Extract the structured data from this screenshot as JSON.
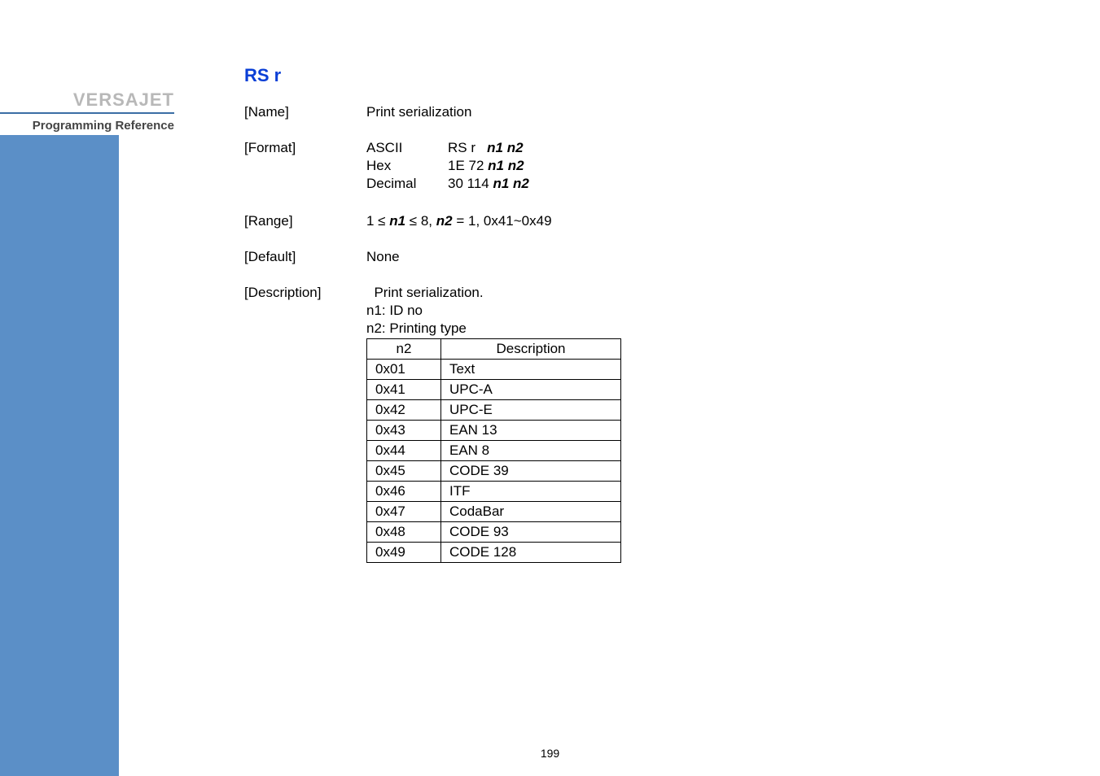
{
  "sidebar": {
    "brand": "VERSAJET",
    "reference": "Programming Reference"
  },
  "command": {
    "title": "RS r"
  },
  "name": {
    "label": "[Name]",
    "value": "Print serialization"
  },
  "format": {
    "label": "[Format]",
    "ascii_key": "ASCII",
    "ascii_prefix": "RS r   ",
    "ascii_args": "n1 n2",
    "hex_key": "Hex",
    "hex_prefix": "1E 72 ",
    "hex_args": "n1 n2",
    "dec_key": "Decimal",
    "dec_prefix": "30 114 ",
    "dec_args": "n1 n2"
  },
  "range": {
    "label": "[Range]",
    "p1": "1 ≤ ",
    "p2": "n1",
    "p3": " ≤ 8, ",
    "p4": "n2",
    "p5": " = 1, 0x41~0x49"
  },
  "default": {
    "label": "[Default]",
    "value": "None"
  },
  "description": {
    "label": "[Description]",
    "line1": "  Print serialization.",
    "line2": "n1: ID no",
    "line3": "n2: Printing type",
    "th_n2": "n2",
    "th_desc": "Description",
    "rows": [
      {
        "code": "0x01",
        "desc": "Text"
      },
      {
        "code": "0x41",
        "desc": "UPC-A"
      },
      {
        "code": "0x42",
        "desc": "UPC-E"
      },
      {
        "code": "0x43",
        "desc": "EAN 13"
      },
      {
        "code": "0x44",
        "desc": "EAN 8"
      },
      {
        "code": "0x45",
        "desc": "CODE 39"
      },
      {
        "code": "0x46",
        "desc": "ITF"
      },
      {
        "code": "0x47",
        "desc": "CodaBar"
      },
      {
        "code": "0x48",
        "desc": "CODE 93"
      },
      {
        "code": "0x49",
        "desc": "CODE 128"
      }
    ]
  },
  "page": "199"
}
